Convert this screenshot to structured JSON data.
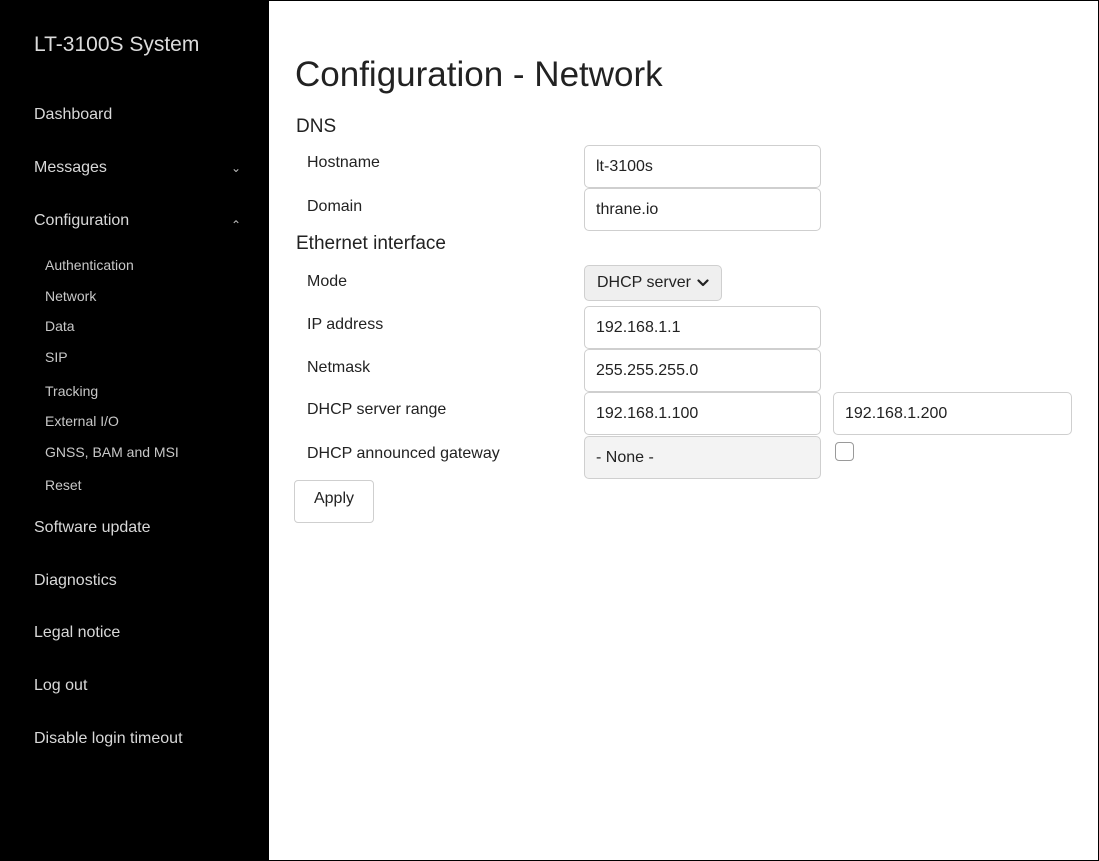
{
  "sidebar": {
    "brand": "LT-3100S System",
    "items": {
      "dashboard": "Dashboard",
      "messages": "Messages",
      "configuration": "Configuration",
      "software_update": "Software update",
      "diagnostics": "Diagnostics",
      "legal_notice": "Legal notice",
      "log_out": "Log out",
      "disable_login_timeout": "Disable login timeout"
    },
    "messages_chevron": "⌄",
    "configuration_chevron": "⌃",
    "config_sub_items": [
      "Authentication",
      "Network",
      "Data",
      "SIP",
      "Tracking",
      "External I/O",
      "GNSS, BAM and MSI",
      "Reset"
    ]
  },
  "main": {
    "title": "Configuration - Network",
    "dns": {
      "heading": "DNS",
      "hostname_label": "Hostname",
      "hostname_value": "lt-3100s",
      "domain_label": "Domain",
      "domain_value": "thrane.io"
    },
    "ethernet": {
      "heading": "Ethernet interface",
      "mode_label": "Mode",
      "mode_value": "DHCP server",
      "ip_label": "IP address",
      "ip_value": "192.168.1.1",
      "netmask_label": "Netmask",
      "netmask_value": "255.255.255.0",
      "dhcp_range_label": "DHCP server range",
      "dhcp_range_start": "192.168.1.100",
      "dhcp_range_end": "192.168.1.200",
      "gateway_label": "DHCP announced gateway",
      "gateway_value": "- None -",
      "gateway_checked": false
    },
    "apply_label": "Apply"
  }
}
